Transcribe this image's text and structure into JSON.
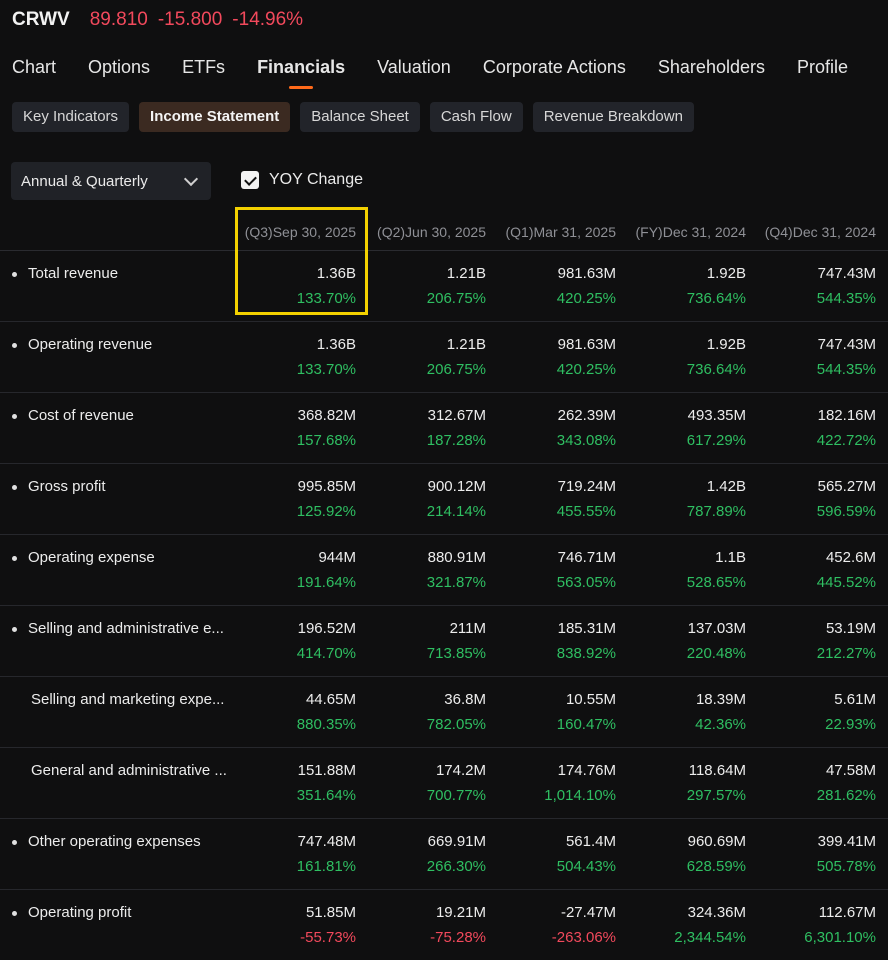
{
  "quote": {
    "ticker": "CRWV",
    "price": "89.810",
    "change": "-15.800",
    "change_pct": "-14.96%"
  },
  "tabs": [
    "Chart",
    "Options",
    "ETFs",
    "Financials",
    "Valuation",
    "Corporate Actions",
    "Shareholders",
    "Profile"
  ],
  "active_tab": "Financials",
  "subtabs": [
    "Key Indicators",
    "Income Statement",
    "Balance Sheet",
    "Cash Flow",
    "Revenue Breakdown"
  ],
  "active_subtab": "Income Statement",
  "period_select": {
    "value": "Annual & Quarterly"
  },
  "yoy_toggle": {
    "label": "YOY Change",
    "checked": true
  },
  "colors": {
    "positive": "#2fbf62",
    "negative": "#f2495c",
    "accent": "#ff6a1a",
    "highlight": "#f3d100"
  },
  "columns": [
    "(Q3)Sep 30, 2025",
    "(Q2)Jun 30, 2025",
    "(Q1)Mar 31, 2025",
    "(FY)Dec 31, 2024",
    "(Q4)Dec 31, 2024"
  ],
  "rows": [
    {
      "label": "Total revenue",
      "bullet": true,
      "values": [
        "1.36B",
        "1.21B",
        "981.63M",
        "1.92B",
        "747.43M"
      ],
      "changes": [
        "133.70%",
        "206.75%",
        "420.25%",
        "736.64%",
        "544.35%"
      ]
    },
    {
      "label": "Operating revenue",
      "bullet": true,
      "values": [
        "1.36B",
        "1.21B",
        "981.63M",
        "1.92B",
        "747.43M"
      ],
      "changes": [
        "133.70%",
        "206.75%",
        "420.25%",
        "736.64%",
        "544.35%"
      ]
    },
    {
      "label": "Cost of revenue",
      "bullet": true,
      "values": [
        "368.82M",
        "312.67M",
        "262.39M",
        "493.35M",
        "182.16M"
      ],
      "changes": [
        "157.68%",
        "187.28%",
        "343.08%",
        "617.29%",
        "422.72%"
      ]
    },
    {
      "label": "Gross profit",
      "bullet": true,
      "values": [
        "995.85M",
        "900.12M",
        "719.24M",
        "1.42B",
        "565.27M"
      ],
      "changes": [
        "125.92%",
        "214.14%",
        "455.55%",
        "787.89%",
        "596.59%"
      ]
    },
    {
      "label": "Operating expense",
      "bullet": true,
      "values": [
        "944M",
        "880.91M",
        "746.71M",
        "1.1B",
        "452.6M"
      ],
      "changes": [
        "191.64%",
        "321.87%",
        "563.05%",
        "528.65%",
        "445.52%"
      ]
    },
    {
      "label": "Selling and administrative e...",
      "bullet": true,
      "values": [
        "196.52M",
        "211M",
        "185.31M",
        "137.03M",
        "53.19M"
      ],
      "changes": [
        "414.70%",
        "713.85%",
        "838.92%",
        "220.48%",
        "212.27%"
      ]
    },
    {
      "label": "Selling and marketing expe...",
      "bullet": false,
      "values": [
        "44.65M",
        "36.8M",
        "10.55M",
        "18.39M",
        "5.61M"
      ],
      "changes": [
        "880.35%",
        "782.05%",
        "160.47%",
        "42.36%",
        "22.93%"
      ]
    },
    {
      "label": "General and administrative ...",
      "bullet": false,
      "values": [
        "151.88M",
        "174.2M",
        "174.76M",
        "118.64M",
        "47.58M"
      ],
      "changes": [
        "351.64%",
        "700.77%",
        "1,014.10%",
        "297.57%",
        "281.62%"
      ]
    },
    {
      "label": "Other operating expenses",
      "bullet": true,
      "values": [
        "747.48M",
        "669.91M",
        "561.4M",
        "960.69M",
        "399.41M"
      ],
      "changes": [
        "161.81%",
        "266.30%",
        "504.43%",
        "628.59%",
        "505.78%"
      ]
    },
    {
      "label": "Operating profit",
      "bullet": true,
      "values": [
        "51.85M",
        "19.21M",
        "-27.47M",
        "324.36M",
        "112.67M"
      ],
      "changes": [
        "-55.73%",
        "-75.28%",
        "-263.06%",
        "2,344.54%",
        "6,301.10%"
      ]
    }
  ]
}
